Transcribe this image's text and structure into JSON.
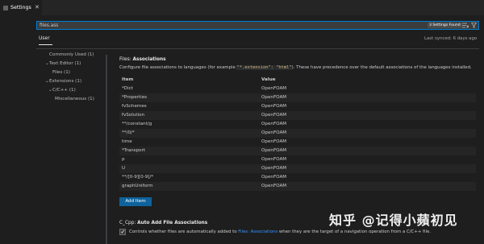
{
  "tab": {
    "label": "Settings",
    "icon": "settings-lines-icon",
    "close_icon": "close-icon"
  },
  "search": {
    "value": "files.ass",
    "results_badge": "3 Settings Found",
    "clear_icon": "clear-filter-icon",
    "filter_icon": "filter-icon"
  },
  "scope": {
    "user_tab": "User",
    "last_synced": "Last synced: 6 days ago"
  },
  "toc": {
    "commonly_used": "Commonly Used (1)",
    "text_editor": "Text Editor (1)",
    "files": "Files (1)",
    "extensions": "Extensions (1)",
    "cpp": "C/C++ (1)",
    "misc": "Miscellaneous (1)"
  },
  "associations": {
    "title_prefix": "Files: ",
    "title_name": "Associations",
    "desc_before": "Configure file associations to languages (for example ",
    "code1": "\"*.extension\": \"html\"",
    "desc_after": "). These have precedence over the default associations of the languages installed.",
    "col_item": "Item",
    "col_value": "Value",
    "rows": [
      {
        "item": "*Dict",
        "value": "OpenFOAM"
      },
      {
        "item": "*Properties",
        "value": "OpenFOAM"
      },
      {
        "item": "fvSchemes",
        "value": "OpenFOAM"
      },
      {
        "item": "fvSolution",
        "value": "OpenFOAM"
      },
      {
        "item": "**/constant/g",
        "value": "OpenFOAM"
      },
      {
        "item": "**/0/*",
        "value": "OpenFOAM"
      },
      {
        "item": "time",
        "value": "OpenFOAM"
      },
      {
        "item": "*Transport",
        "value": "OpenFOAM"
      },
      {
        "item": "p",
        "value": "OpenFOAM"
      },
      {
        "item": "U",
        "value": "OpenFOAM"
      },
      {
        "item": "**/[0-9][0-9]/*",
        "value": "OpenFOAM"
      },
      {
        "item": "graphUniform",
        "value": "OpenFOAM"
      }
    ],
    "add_button": "Add Item"
  },
  "auto_add": {
    "title_prefix": "C_Cpp: ",
    "title_name": "Auto Add File Associations",
    "checked": true,
    "desc_before": "Controls whether files are automatically added to ",
    "link": "Files: Associations",
    "desc_after": " when they are the target of a navigation operation from a C/C++ file."
  },
  "watermark": "知乎 @记得小蘋初见",
  "colors": {
    "accent": "#0e639c",
    "focus": "#007fd4",
    "link": "#3794ff",
    "background": "#1e1e1e"
  }
}
